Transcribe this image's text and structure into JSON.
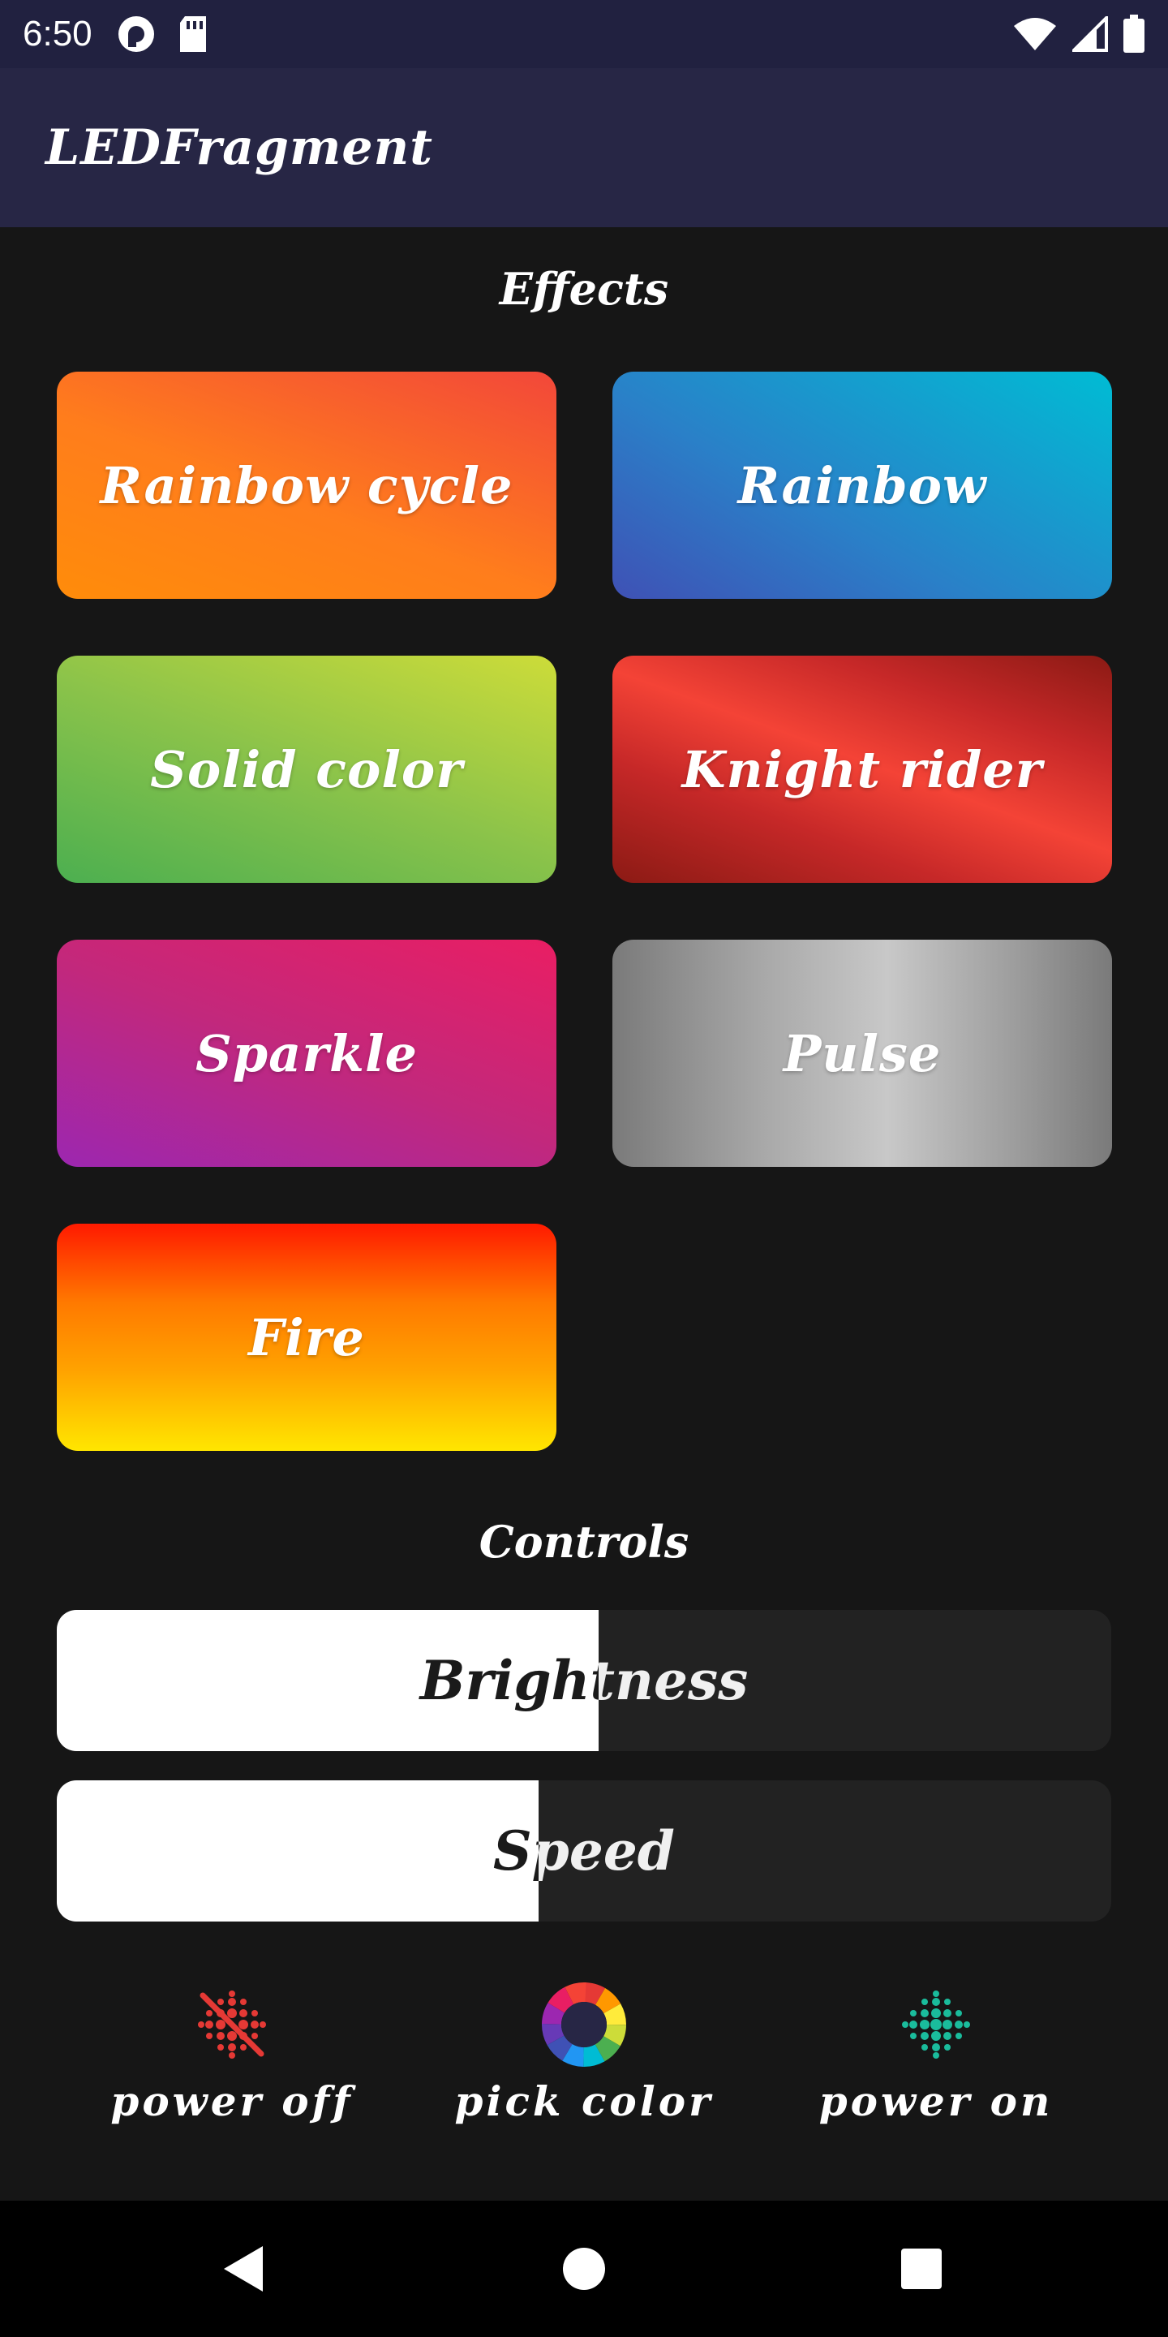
{
  "status_bar": {
    "time": "6:50",
    "left_icons": [
      "pocket-casts-icon",
      "sd-card-icon"
    ],
    "right_icons": [
      "wifi-icon",
      "cellular-signal-icon",
      "battery-icon"
    ]
  },
  "app_bar": {
    "title": "LEDFragment"
  },
  "effects": {
    "title": "Effects",
    "buttons": [
      {
        "label": "Rainbow cycle"
      },
      {
        "label": "Rainbow"
      },
      {
        "label": "Solid color"
      },
      {
        "label": "Knight rider"
      },
      {
        "label": "Sparkle"
      },
      {
        "label": "Pulse"
      },
      {
        "label": "Fire"
      }
    ]
  },
  "controls": {
    "title": "Controls",
    "brightness": {
      "label": "Brightness",
      "level": 0.514
    },
    "speed": {
      "label": "Speed",
      "level": 0.457
    }
  },
  "actions": {
    "power_off": {
      "label": "power off",
      "icon": "led-off-icon",
      "color": "#e53935"
    },
    "pick_color": {
      "label": "pick color",
      "icon": "color-wheel-icon"
    },
    "power_on": {
      "label": "power on",
      "icon": "led-on-icon",
      "color": "#1abc9c"
    }
  },
  "nav_bar": {
    "icons": [
      "back-icon",
      "home-icon",
      "recents-icon"
    ]
  },
  "colors": {
    "status_bar": "#212140",
    "app_bar": "#272645",
    "background": "#161616"
  }
}
